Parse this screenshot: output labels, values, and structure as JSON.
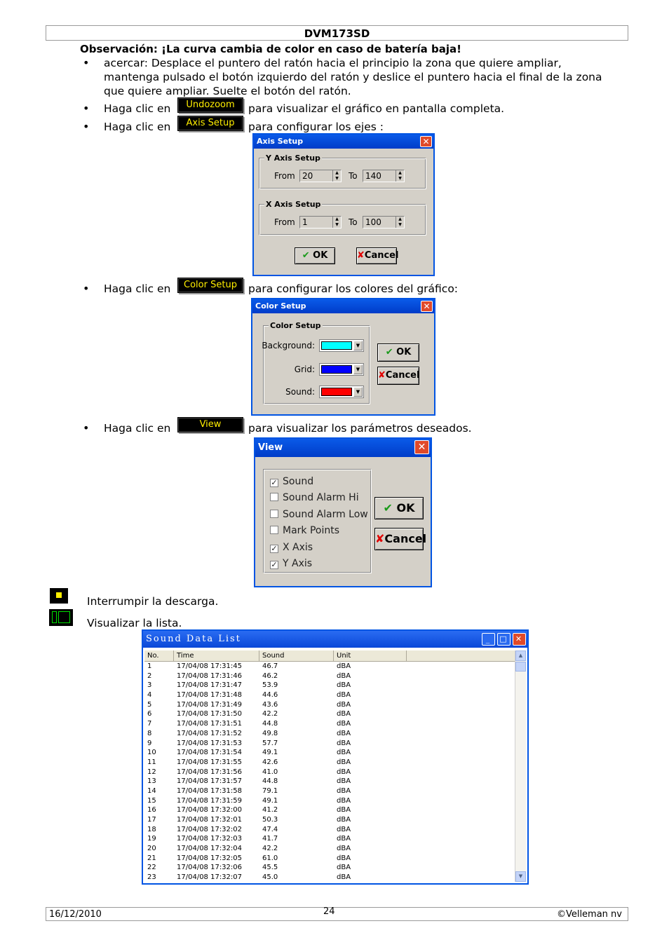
{
  "header": {
    "title": "DVM173SD"
  },
  "note": "Observación: ¡La curva cambia de color en caso de batería baja!",
  "bullets": {
    "zoom": "acercar: Desplace el puntero del ratón hacia el principio la zona que quiere ampliar, mantenga pulsado el botón izquierdo del ratón y deslice el puntero hacia el final de la zona que quiere ampliar. Suelte el botón del ratón.",
    "click_prefix": "Haga clic en",
    "undozoom_label": "Undozoom",
    "undozoom_text": "para visualizar el gráfico en pantalla completa.",
    "axis_label": "Axis Setup",
    "axis_text": "para configurar los ejes :",
    "color_label": "Color Setup",
    "color_text": "para configurar los colores del gráfico:",
    "view_label": "View",
    "view_text": "para visualizar los parámetros deseados."
  },
  "axis_dialog": {
    "title": "Axis Setup",
    "y_group": "Y Axis Setup",
    "x_group": "X Axis Setup",
    "from_label": "From",
    "to_label": "To",
    "y_from": "20",
    "y_to": "140",
    "x_from": "1",
    "x_to": "100",
    "ok": "OK",
    "cancel": "Cancel"
  },
  "color_dialog": {
    "title": "Color Setup",
    "group": "Color Setup",
    "background_label": "Background:",
    "grid_label": "Grid:",
    "sound_label": "Sound:",
    "colors": {
      "background": "#00ffff",
      "grid": "#0000ff",
      "sound": "#ff0000"
    },
    "ok": "OK",
    "cancel": "Cancel"
  },
  "view_dialog": {
    "title": "View",
    "options": [
      {
        "label": "Sound",
        "checked": true
      },
      {
        "label": "Sound Alarm Hi",
        "checked": false
      },
      {
        "label": "Sound Alarm Low",
        "checked": false
      },
      {
        "label": "Mark Points",
        "checked": false
      },
      {
        "label": "X Axis",
        "checked": true
      },
      {
        "label": "Y Axis",
        "checked": true
      }
    ],
    "ok": "OK",
    "cancel": "Cancel"
  },
  "icons": {
    "stop_text": "Interrumpir la descarga.",
    "list_text": "Visualizar la lista."
  },
  "sound_list": {
    "title": "Sound Data List",
    "columns": [
      "No.",
      "Time",
      "Sound",
      "Unit"
    ],
    "rows": [
      [
        "1",
        "17/04/08 17:31:45",
        "46.7",
        "dBA"
      ],
      [
        "2",
        "17/04/08 17:31:46",
        "46.2",
        "dBA"
      ],
      [
        "3",
        "17/04/08 17:31:47",
        "53.9",
        "dBA"
      ],
      [
        "4",
        "17/04/08 17:31:48",
        "44.6",
        "dBA"
      ],
      [
        "5",
        "17/04/08 17:31:49",
        "43.6",
        "dBA"
      ],
      [
        "6",
        "17/04/08 17:31:50",
        "42.2",
        "dBA"
      ],
      [
        "7",
        "17/04/08 17:31:51",
        "44.8",
        "dBA"
      ],
      [
        "8",
        "17/04/08 17:31:52",
        "49.8",
        "dBA"
      ],
      [
        "9",
        "17/04/08 17:31:53",
        "57.7",
        "dBA"
      ],
      [
        "10",
        "17/04/08 17:31:54",
        "49.1",
        "dBA"
      ],
      [
        "11",
        "17/04/08 17:31:55",
        "42.6",
        "dBA"
      ],
      [
        "12",
        "17/04/08 17:31:56",
        "41.0",
        "dBA"
      ],
      [
        "13",
        "17/04/08 17:31:57",
        "44.8",
        "dBA"
      ],
      [
        "14",
        "17/04/08 17:31:58",
        "79.1",
        "dBA"
      ],
      [
        "15",
        "17/04/08 17:31:59",
        "49.1",
        "dBA"
      ],
      [
        "16",
        "17/04/08 17:32:00",
        "41.2",
        "dBA"
      ],
      [
        "17",
        "17/04/08 17:32:01",
        "50.3",
        "dBA"
      ],
      [
        "18",
        "17/04/08 17:32:02",
        "47.4",
        "dBA"
      ],
      [
        "19",
        "17/04/08 17:32:03",
        "41.7",
        "dBA"
      ],
      [
        "20",
        "17/04/08 17:32:04",
        "42.2",
        "dBA"
      ],
      [
        "21",
        "17/04/08 17:32:05",
        "61.0",
        "dBA"
      ],
      [
        "22",
        "17/04/08 17:32:06",
        "45.5",
        "dBA"
      ],
      [
        "23",
        "17/04/08 17:32:07",
        "45.0",
        "dBA"
      ]
    ]
  },
  "footer": {
    "date": "16/12/2010",
    "page": "24",
    "copyright": "©Velleman nv"
  }
}
